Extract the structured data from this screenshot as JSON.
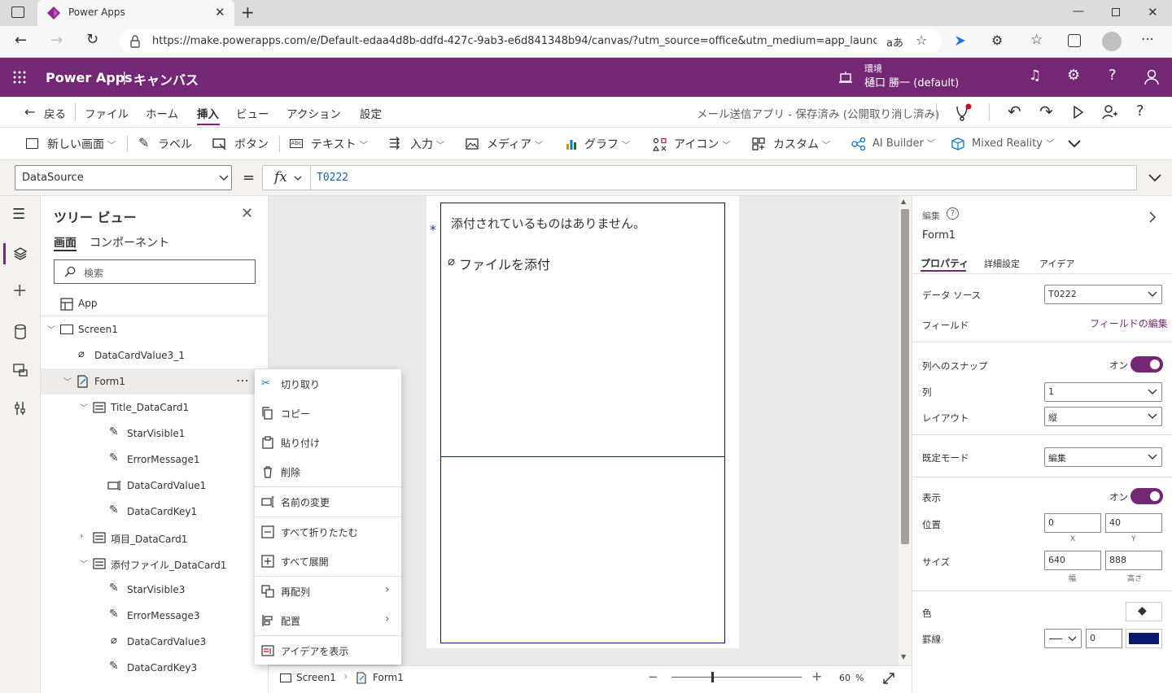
{
  "browser": {
    "tab_title": "Power Apps",
    "url": "https://make.powerapps.com/e/Default-edaa4d8b-ddfd-427c-9ab3-e6d841348b94/canvas/?utm_source=office&utm_medium=app_launcher...",
    "read_aloud": "aあ"
  },
  "header": {
    "product": "Power Apps",
    "separator": "|",
    "mode": "キャンバス",
    "env_label": "環境",
    "env_name": "樋口 勝一 (default)"
  },
  "cmdbar": {
    "back": "戻る",
    "menus": [
      "ファイル",
      "ホーム",
      "挿入",
      "ビュー",
      "アクション",
      "設定"
    ],
    "status": "メール送信アプリ - 保存済み (公開取り消し済み)"
  },
  "insert": {
    "items": [
      "新しい画面",
      "ラベル",
      "ボタン",
      "テキスト",
      "入力",
      "メディア",
      "グラフ",
      "アイコン",
      "カスタム",
      "AI Builder",
      "Mixed Reality"
    ]
  },
  "formula": {
    "property": "DataSource",
    "equals": "=",
    "fx": "fx",
    "value": "T0222"
  },
  "tree": {
    "title": "ツリー ビュー",
    "tabs": [
      "画面",
      "コンポーネント"
    ],
    "search_placeholder": "検索",
    "items": [
      {
        "label": "App"
      },
      {
        "label": "Screen1"
      },
      {
        "label": "DataCardValue3_1"
      },
      {
        "label": "Form1"
      },
      {
        "label": "Title_DataCard1"
      },
      {
        "label": "StarVisible1"
      },
      {
        "label": "ErrorMessage1"
      },
      {
        "label": "DataCardValue1"
      },
      {
        "label": "DataCardKey1"
      },
      {
        "label": "項目_DataCard1"
      },
      {
        "label": "添付ファイル_DataCard1"
      },
      {
        "label": "StarVisible3"
      },
      {
        "label": "ErrorMessage3"
      },
      {
        "label": "DataCardValue3"
      },
      {
        "label": "DataCardKey3"
      }
    ]
  },
  "context_menu": {
    "items": [
      "切り取り",
      "コピー",
      "貼り付け",
      "削除",
      "名前の変更",
      "すべて折りたたむ",
      "すべて展開",
      "再配列",
      "配置",
      "アイデアを表示"
    ]
  },
  "canvas": {
    "no_attach": "添付されているものはありません。",
    "attach_file": "ファイルを添付",
    "star": "*"
  },
  "status": {
    "crumb1": "Screen1",
    "crumb2": "Form1",
    "zoom": "60",
    "zoom_unit": "%",
    "minus": "−",
    "plus": "+"
  },
  "props": {
    "section": "編集",
    "control": "Form1",
    "tabs": [
      "プロパティ",
      "詳細設定",
      "アイデア"
    ],
    "datasource_label": "データ ソース",
    "datasource_value": "T0222",
    "fields_label": "フィールド",
    "fields_edit": "フィールドの編集",
    "snap_label": "列へのスナップ",
    "snap_value": "オン",
    "columns_label": "列",
    "columns_value": "1",
    "layout_label": "レイアウト",
    "layout_value": "縦",
    "mode_label": "既定モード",
    "mode_value": "編集",
    "visible_label": "表示",
    "visible_value": "オン",
    "position_label": "位置",
    "pos_x": "0",
    "pos_y": "40",
    "pos_x_label": "X",
    "pos_y_label": "Y",
    "size_label": "サイズ",
    "width": "640",
    "height": "888",
    "width_label": "幅",
    "height_label": "高さ",
    "color_label": "色",
    "border_label": "罫線",
    "border_width": "0",
    "border_color": "#0b1a6e",
    "accent": "#742774"
  }
}
